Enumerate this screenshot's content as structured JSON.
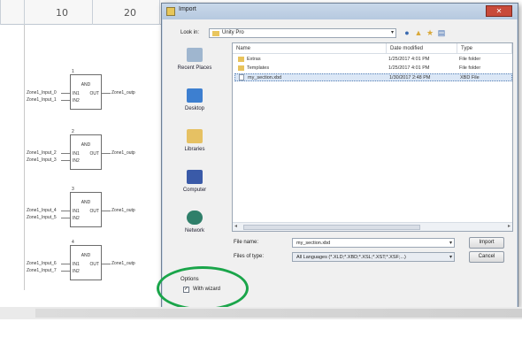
{
  "editor": {
    "ruler": [
      "10",
      "20"
    ],
    "blocks": [
      {
        "index": "1",
        "name": "AND",
        "in1": "IN1",
        "in2": "IN2",
        "out": "OUT",
        "sig_in1": "Zone1_Input_0",
        "sig_in2": "Zone1_Input_1",
        "sig_out": "Zone1_outp"
      },
      {
        "index": "2",
        "name": "AND",
        "in1": "IN1",
        "in2": "IN2",
        "out": "OUT",
        "sig_in1": "Zone1_Input_2",
        "sig_in2": "Zone1_Input_3",
        "sig_out": "Zone1_outp"
      },
      {
        "index": "3",
        "name": "AND",
        "in1": "IN1",
        "in2": "IN2",
        "out": "OUT",
        "sig_in1": "Zone1_Input_4",
        "sig_in2": "Zone1_Input_5",
        "sig_out": "Zone1_outp"
      },
      {
        "index": "4",
        "name": "AND",
        "in1": "IN1",
        "in2": "IN2",
        "out": "OUT",
        "sig_in1": "Zone1_Input_6",
        "sig_in2": "Zone1_Input_7",
        "sig_out": "Zone1_outp"
      }
    ]
  },
  "dialog": {
    "title": "Import",
    "look_in_label": "Look in:",
    "look_in_value": "Unity Pro",
    "places": [
      {
        "label": "Recent Places",
        "icon": "recent-places-icon"
      },
      {
        "label": "Desktop",
        "icon": "desktop-icon"
      },
      {
        "label": "Libraries",
        "icon": "libraries-icon"
      },
      {
        "label": "Computer",
        "icon": "computer-icon"
      },
      {
        "label": "Network",
        "icon": "network-icon"
      }
    ],
    "columns": {
      "name": "Name",
      "date": "Date modified",
      "type": "Type"
    },
    "files": [
      {
        "name": "Extras",
        "date": "1/25/2017 4:01 PM",
        "type": "File folder",
        "kind": "folder"
      },
      {
        "name": "Templates",
        "date": "1/25/2017 4:01 PM",
        "type": "File folder",
        "kind": "folder"
      },
      {
        "name": "my_section.xbd",
        "date": "1/30/2017 2:48 PM",
        "type": "XBD File",
        "kind": "file"
      }
    ],
    "file_name_label": "File name:",
    "file_name_value": "my_section.xbd",
    "file_type_label": "Files of type:",
    "file_type_value": "All Languages (*.XLD;*.XBD;*.XSL;*.XST;*.XSF;...)",
    "import_button": "Import",
    "cancel_button": "Cancel",
    "options_label": "Options",
    "wizard_label": "With wizard",
    "wizard_checked": "✓"
  }
}
